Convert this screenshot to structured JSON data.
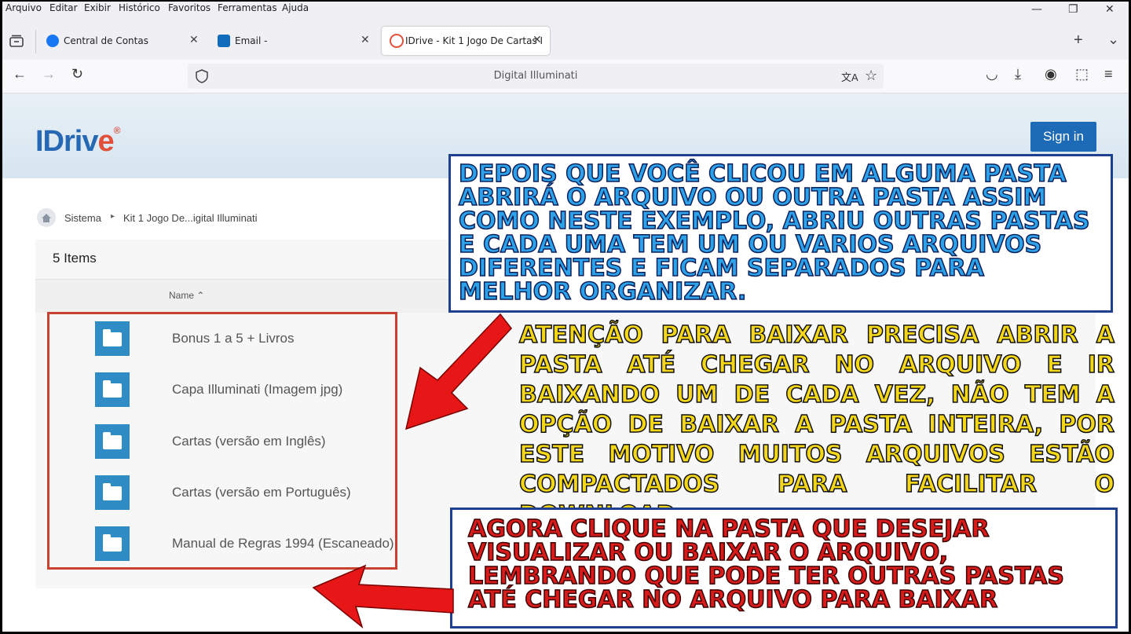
{
  "menu": {
    "items": [
      "Arquivo",
      "Editar",
      "Exibir",
      "Histórico",
      "Favoritos",
      "Ferramentas",
      "Ajuda"
    ],
    "window_controls": {
      "minimize": "—",
      "restore": "❐",
      "close": "✕"
    }
  },
  "tabs": [
    {
      "label": "Central de Contas",
      "icon": "facebook-icon",
      "close": "✕"
    },
    {
      "label": "Email -",
      "icon": "outlook-icon",
      "close": "✕"
    },
    {
      "label": "IDrive - Kit 1 Jogo De Cartas I",
      "icon": "idrive-icon",
      "close": "✕"
    }
  ],
  "tab_actions": {
    "new_tab": "+",
    "list": "⌄"
  },
  "nav": {
    "back": "←",
    "forward": "→",
    "reload": "↻",
    "url_text": "Digital Illuminati",
    "translate": "文A",
    "bookmark": "☆",
    "pocket": "◡",
    "downloads": "⤓",
    "account": "◉",
    "extensions": "⬚",
    "menu": "≡"
  },
  "header": {
    "logo_text": "IDriv",
    "logo_e": "e",
    "logo_reg": "®",
    "signin_label": "Sign in"
  },
  "breadcrumb": {
    "root": "Sistema",
    "separator": "▸",
    "current": "Kit 1 Jogo De...igital Illuminati"
  },
  "list": {
    "count": "5 Items",
    "column_name": "Name ⌃",
    "items": [
      "Bonus 1 a 5 + Livros",
      "Capa Illuminati (Imagem jpg)",
      "Cartas (versão em Inglês)",
      "Cartas (versão em Português)",
      "Manual de Regras 1994 (Escaneado)"
    ]
  },
  "annotations": {
    "note1": "DEPOIS QUE VOCÊ CLICOU EM ALGUMA PASTA ABRIRÁ O ARQUIVO OU OUTRA PASTA ASSIM COMO NESTE EXEMPLO, ABRIU OUTRAS PASTAS E CADA UMA TEM UM OU VARIOS ARQUIVOS DIFERENTES E FICAM SEPARADOS PARA MELHOR ORGANIZAR.",
    "note2": "ATENÇÃO PARA BAIXAR PRECISA ABRIR A PASTA ATÉ CHEGAR NO ARQUIVO E IR BAIXANDO UM DE CADA VEZ, NÃO TEM A OPÇÃO DE BAIXAR A PASTA INTEIRA, POR ESTE MOTIVO MUITOS ARQUIVOS ESTÃO COMPACTADOS PARA FACILITAR O DOWNLOAD.",
    "note3": "AGORA CLIQUE NA PASTA QUE DESEJAR VISUALIZAR OU BAIXAR O ARQUIVO, LEMBRANDO QUE PODE TER OUTRAS PASTAS ATÉ CHEGAR NO ARQUIVO PARA BAIXAR"
  },
  "colors": {
    "accent": "#1d6bb6",
    "arrow": "#e81717",
    "folder": "#2f8cc4",
    "highlight_border": "#c9412f"
  }
}
